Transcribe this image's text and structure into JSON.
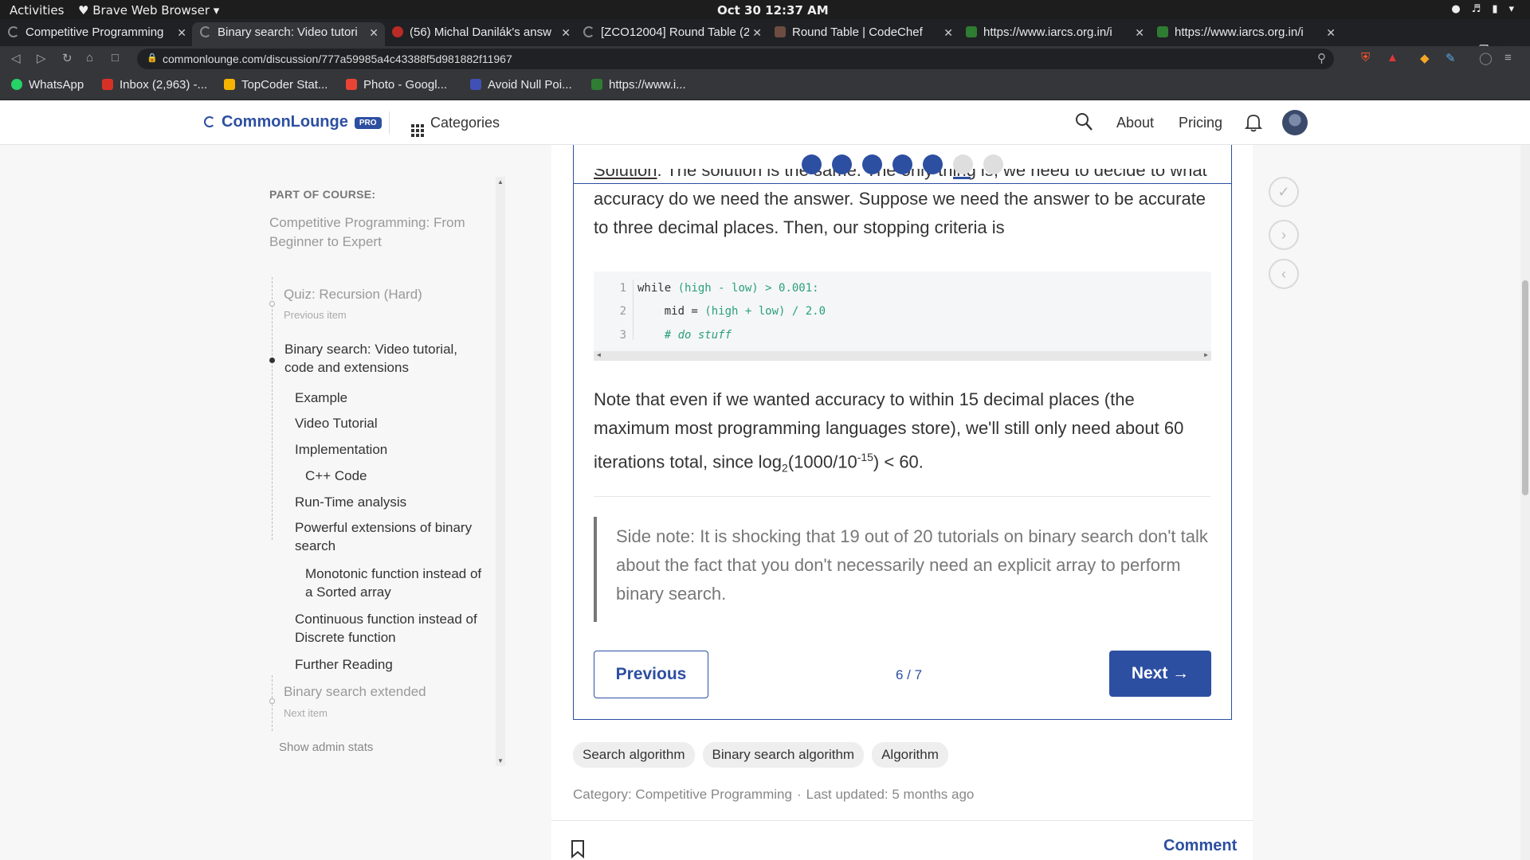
{
  "os": {
    "activities": "Activities",
    "app_menu": "Brave Web Browser",
    "clock": "Oct 30  12:37 AM"
  },
  "tabs": [
    {
      "label": "Competitive Programming",
      "color": "#888888"
    },
    {
      "label": "Binary search: Video tutori",
      "color": "#888888"
    },
    {
      "label": "(56) Michal Danilák's answ",
      "color": "#b92b27"
    },
    {
      "label": "[ZCO12004] Round Table (2",
      "color": "#888888"
    },
    {
      "label": "Round Table | CodeChef",
      "color": "#6d4c41"
    },
    {
      "label": "https://www.iarcs.org.in/i",
      "color": "#2e7d32"
    },
    {
      "label": "https://www.iarcs.org.in/i",
      "color": "#2e7d32"
    }
  ],
  "address": {
    "url": "commonlounge.com/discussion/777a59985a4c43388f5d981882f11967"
  },
  "bookmarks": [
    {
      "label": "WhatsApp",
      "color": "#25d366"
    },
    {
      "label": "Inbox (2,963) -...",
      "color": "#d93025"
    },
    {
      "label": "TopCoder Stat...",
      "color": "#f4b400"
    },
    {
      "label": "Photo - Googl...",
      "color": "#ea4335"
    },
    {
      "label": "Avoid Null Poi...",
      "color": "#3f51b5"
    },
    {
      "label": "https://www.i...",
      "color": "#2e7d32"
    }
  ],
  "header": {
    "brand": "CommonLounge",
    "pro_badge": "PRO",
    "categories": "Categories",
    "about": "About",
    "pricing": "Pricing",
    "accent_color": "#2d4fa1"
  },
  "sidebar": {
    "part_of_course": "PART OF COURSE:",
    "course_title": "Competitive Programming: From Beginner to Expert",
    "prev_item": "Quiz: Recursion (Hard)",
    "prev_caption": "Previous item",
    "current_item": "Binary search: Video tutorial, code and extensions",
    "sections": [
      "Example",
      "Video Tutorial",
      "Implementation",
      "C++ Code",
      "Run-Time analysis",
      "Powerful extensions of binary search",
      "Monotonic function instead of a Sorted array",
      "Continuous function instead of Discrete function",
      "Further Reading"
    ],
    "next_item": "Binary search extended",
    "next_caption": "Next item",
    "admin_stats": "Show admin stats"
  },
  "content": {
    "progress_total": 7,
    "progress_current": 6,
    "solution_label": "Solution",
    "para1_rest": ": The solution is the same. The only thing is, we need to decide to what accuracy do we need the answer. Suppose we need the answer to be accurate to three decimal places. Then, our stopping criteria is",
    "code_lines": [
      {
        "num": "1",
        "kw": "while",
        "rest": " (high - low) > 0.001:"
      },
      {
        "num": "2",
        "kw": "    mid = ",
        "rest": "(high + low) / 2.0"
      },
      {
        "num": "3",
        "kw": "",
        "rest": "    # do stuff"
      }
    ],
    "para2_a": "Note that even if we wanted accuracy to within 15 decimal places (the maximum most programming languages store), we'll still only need about 60 iterations total, since log",
    "para2_sub": "2",
    "para2_b": "(1000/10",
    "para2_sup": "-15",
    "para2_c": ") < 60.",
    "side_note": "Side note: It is shocking that 19 out of 20 tutorials on binary search don't talk about the fact that you don't necessarily need an explicit array to perform binary search.",
    "previous_button": "Previous",
    "pager": "6 / 7",
    "next_button": "Next →"
  },
  "tags": [
    "Search algorithm",
    "Binary search algorithm",
    "Algorithm"
  ],
  "meta": {
    "category": "Category: Competitive Programming",
    "separator": "·",
    "updated": "Last updated: 5 months ago"
  },
  "footer": {
    "comment": "Comment"
  }
}
